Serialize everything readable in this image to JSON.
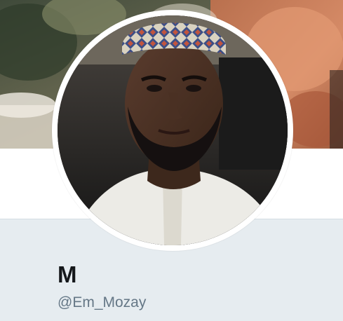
{
  "profile": {
    "display_name": "M",
    "handle": "@Em_Mozay"
  },
  "colors": {
    "panel_background": "#e6ecf0",
    "name_text": "#14171a",
    "handle_text": "#657786",
    "avatar_ring": "#ffffff"
  },
  "icons": {
    "banner": "header-photo",
    "avatar": "profile-photo"
  }
}
